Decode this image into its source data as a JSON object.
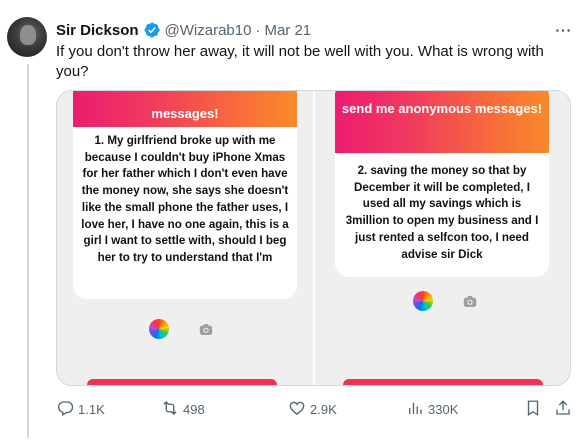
{
  "author": {
    "name": "Sir Dickson",
    "handle": "@Wizarab10",
    "separator": "·",
    "date": "Mar 21"
  },
  "tweet_text": "If you don't throw her away, it will not be well with you. What is wrong with you?",
  "media": {
    "left": {
      "banner": "messages!",
      "card_text": "1. My girlfriend broke up with me because I couldn't buy iPhone Xmas for her father which I don't even have the money now, she says she doesn't like the small phone the father uses, I love her, I have no one again, this is a girl I want to settle with, should I beg her to try to understand that I'm"
    },
    "right": {
      "banner": "send me anonymous messages!",
      "card_text": "2. saving the money so that by December it will be completed, I used all my savings which is 3million to open my business and I just rented a selfcon too, I need advise sir Dick"
    }
  },
  "actions": {
    "replies": "1.1K",
    "reposts": "498",
    "likes": "2.9K",
    "views": "330K"
  },
  "colors": {
    "accent": "#1d9bf0",
    "muted": "#536471",
    "banner_start": "#ec1c6f",
    "banner_end": "#fa8a2a"
  },
  "icons": [
    "verified-badge-icon",
    "more-icon",
    "reply-icon",
    "repost-icon",
    "like-icon",
    "views-icon",
    "bookmark-icon",
    "share-icon"
  ]
}
